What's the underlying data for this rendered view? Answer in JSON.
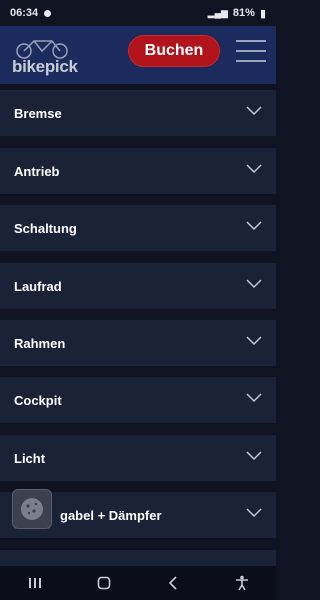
{
  "status_bar": {
    "time": "06:34",
    "battery": "81%"
  },
  "header": {
    "logo_text": "bikepick",
    "book_button_label": "Buchen"
  },
  "accordion": {
    "items": [
      {
        "label": "Bremse"
      },
      {
        "label": "Antrieb"
      },
      {
        "label": "Schaltung"
      },
      {
        "label": "Laufrad"
      },
      {
        "label": "Rahmen"
      },
      {
        "label": "Cockpit"
      },
      {
        "label": "Licht"
      },
      {
        "label": "gabel + Dämpfer"
      }
    ]
  },
  "colors": {
    "background": "#0f1322",
    "header": "#1b2b5e",
    "row": "#1a2238",
    "accent_button": "#b1141b"
  },
  "icons": {
    "row_toggle": "chevron-down-icon",
    "menu": "hamburger-menu-icon",
    "cookie": "cookie-icon",
    "nav_recents": "recent-apps-icon",
    "nav_home": "home-icon",
    "nav_back": "back-icon",
    "nav_accessibility": "accessibility-icon"
  }
}
